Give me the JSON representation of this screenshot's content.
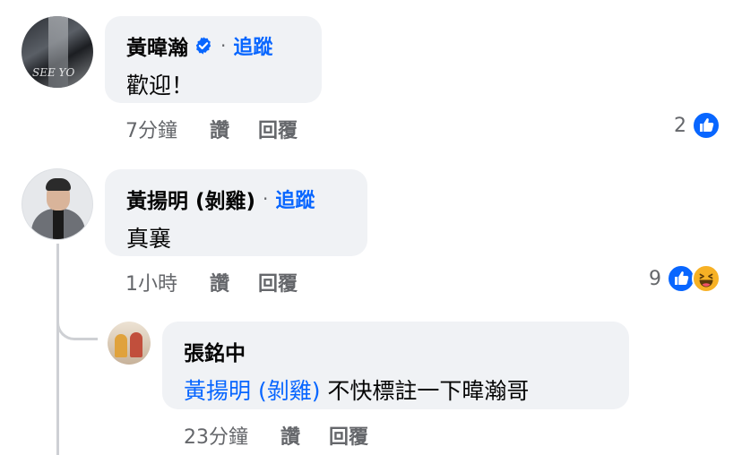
{
  "comments": [
    {
      "author": "黃暐瀚",
      "verified": true,
      "separator": "·",
      "follow_label": "追蹤",
      "text": "歡迎！",
      "time": "7分鐘",
      "like_label": "讚",
      "reply_label": "回覆",
      "reaction_count": "2",
      "reactions": [
        "like-icon"
      ]
    },
    {
      "author": "黃揚明 (剝雞)",
      "verified": false,
      "separator": "·",
      "follow_label": "追蹤",
      "text": "真襄",
      "time": "1小時",
      "like_label": "讚",
      "reply_label": "回覆",
      "reaction_count": "9",
      "reactions": [
        "like-icon",
        "haha-icon"
      ]
    }
  ],
  "reply": {
    "author": "張銘中",
    "mention": "黃揚明 (剝雞)",
    "text": " 不快標註一下暐瀚哥",
    "time": "23分鐘",
    "like_label": "讚",
    "reply_label": "回覆"
  },
  "colors": {
    "bubble": "#f0f2f5",
    "link": "#0866ff",
    "meta": "#65676b",
    "like": "#0866ff",
    "haha": "#f7b125"
  }
}
